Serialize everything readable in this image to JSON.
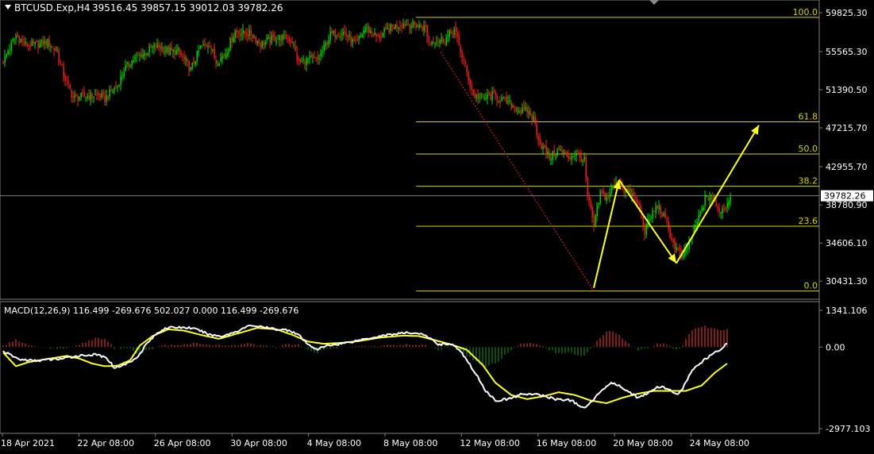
{
  "header": {
    "symbol": "BTCUSD.Exp,H4",
    "ohlc": "39516.45 39857.15 39012.03 39782.26"
  },
  "colors": {
    "background": "#000000",
    "bull_candle": "#00e000",
    "bear_candle": "#ff2020",
    "fib_lines": "#d4d400",
    "arrows": "#ffff22",
    "bid_line": "#7f7f7f",
    "macd_main": "#ffffff",
    "macd_signal": "#ffff22",
    "hist_pos": "#ff3b3b",
    "hist_neg": "#1e9a1e",
    "axis_text": "#ffffff",
    "price_box_bg": "#ffffff",
    "price_box_text": "#000000"
  },
  "price_axis": {
    "labels": [
      "59825.30",
      "55565.30",
      "51390.50",
      "47215.70",
      "42955.70",
      "38780.90",
      "34606.10",
      "30431.30"
    ],
    "current_price": "39782.26"
  },
  "fibonacci": {
    "levels": [
      {
        "label": "100.0",
        "price": 59320
      },
      {
        "label": "61.8",
        "price": 47880
      },
      {
        "label": "50.0",
        "price": 44360
      },
      {
        "label": "38.2",
        "price": 40830
      },
      {
        "label": "23.6",
        "price": 36450
      },
      {
        "label": "0.0",
        "price": 29350
      }
    ]
  },
  "macd": {
    "label": "MACD(12,26,9) 116.499 -269.676 502.027 0.000 116.499 -269.676",
    "axis_labels": [
      "1341.106",
      "0.00",
      "-2977.103"
    ],
    "ylim": [
      -2977.103,
      1341.106
    ]
  },
  "time_axis": {
    "labels": [
      "18 Apr 2021",
      "22 Apr 08:00",
      "26 Apr 08:00",
      "30 Apr 08:00",
      "4 May 08:00",
      "8 May 08:00",
      "12 May 08:00",
      "16 May 08:00",
      "20 May 08:00",
      "24 May 08:00"
    ]
  },
  "chart_data": {
    "type": "candlestick",
    "symbol": "BTCUSD.Exp,H4",
    "ylim": [
      28800,
      60800
    ],
    "price_anchors": [
      [
        0,
        54500
      ],
      [
        4,
        56000
      ],
      [
        8,
        57300
      ],
      [
        14,
        56300
      ],
      [
        20,
        56300
      ],
      [
        28,
        56600
      ],
      [
        34,
        55500
      ],
      [
        38,
        53000
      ],
      [
        44,
        50500
      ],
      [
        52,
        50700
      ],
      [
        60,
        50800
      ],
      [
        64,
        50400
      ],
      [
        68,
        51200
      ],
      [
        72,
        51800
      ],
      [
        76,
        53600
      ],
      [
        82,
        54700
      ],
      [
        90,
        55500
      ],
      [
        96,
        56200
      ],
      [
        104,
        55600
      ],
      [
        110,
        55600
      ],
      [
        118,
        53600
      ],
      [
        124,
        56000
      ],
      [
        130,
        56400
      ],
      [
        134,
        54400
      ],
      [
        140,
        55400
      ],
      [
        146,
        57800
      ],
      [
        150,
        57600
      ],
      [
        156,
        57500
      ],
      [
        162,
        56400
      ],
      [
        170,
        57000
      ],
      [
        178,
        57100
      ],
      [
        182,
        56700
      ],
      [
        186,
        54300
      ],
      [
        192,
        54700
      ],
      [
        198,
        54600
      ],
      [
        206,
        57400
      ],
      [
        214,
        57700
      ],
      [
        222,
        56300
      ],
      [
        228,
        58200
      ],
      [
        236,
        57100
      ],
      [
        242,
        58000
      ],
      [
        250,
        58600
      ],
      [
        258,
        58500
      ],
      [
        266,
        58200
      ],
      [
        268,
        56600
      ],
      [
        272,
        56800
      ],
      [
        278,
        56900
      ],
      [
        284,
        58000
      ],
      [
        290,
        54500
      ],
      [
        296,
        50800
      ],
      [
        302,
        50400
      ],
      [
        308,
        50800
      ],
      [
        314,
        50300
      ],
      [
        320,
        49700
      ],
      [
        326,
        49000
      ],
      [
        330,
        49100
      ],
      [
        334,
        48200
      ],
      [
        338,
        45500
      ],
      [
        344,
        44000
      ],
      [
        350,
        44800
      ],
      [
        356,
        44000
      ],
      [
        360,
        44400
      ],
      [
        366,
        43600
      ],
      [
        368,
        39700
      ],
      [
        372,
        36500
      ],
      [
        376,
        40000
      ],
      [
        380,
        39500
      ],
      [
        384,
        40800
      ],
      [
        388,
        41300
      ],
      [
        392,
        40300
      ],
      [
        396,
        39800
      ],
      [
        400,
        38800
      ],
      [
        404,
        36000
      ],
      [
        408,
        37600
      ],
      [
        412,
        38700
      ],
      [
        418,
        36800
      ],
      [
        422,
        34500
      ],
      [
        428,
        33000
      ],
      [
        434,
        35500
      ],
      [
        438,
        37400
      ],
      [
        442,
        39400
      ],
      [
        446,
        39700
      ],
      [
        450,
        38200
      ],
      [
        454,
        38300
      ],
      [
        458,
        39800
      ]
    ],
    "macd_main_anchors": [
      [
        0,
        -150
      ],
      [
        10,
        -450
      ],
      [
        20,
        -500
      ],
      [
        30,
        -450
      ],
      [
        38,
        -420
      ],
      [
        44,
        -350
      ],
      [
        50,
        -300
      ],
      [
        60,
        -280
      ],
      [
        66,
        -450
      ],
      [
        70,
        -750
      ],
      [
        76,
        -650
      ],
      [
        82,
        -480
      ],
      [
        86,
        -250
      ],
      [
        90,
        100
      ],
      [
        96,
        450
      ],
      [
        102,
        700
      ],
      [
        110,
        720
      ],
      [
        118,
        700
      ],
      [
        124,
        600
      ],
      [
        130,
        450
      ],
      [
        138,
        400
      ],
      [
        146,
        550
      ],
      [
        156,
        800
      ],
      [
        164,
        720
      ],
      [
        172,
        650
      ],
      [
        180,
        620
      ],
      [
        186,
        450
      ],
      [
        192,
        80
      ],
      [
        198,
        -80
      ],
      [
        204,
        50
      ],
      [
        212,
        120
      ],
      [
        220,
        200
      ],
      [
        228,
        300
      ],
      [
        240,
        430
      ],
      [
        250,
        500
      ],
      [
        256,
        520
      ],
      [
        262,
        500
      ],
      [
        268,
        350
      ],
      [
        274,
        100
      ],
      [
        280,
        120
      ],
      [
        284,
        60
      ],
      [
        290,
        -300
      ],
      [
        298,
        -1000
      ],
      [
        304,
        -1600
      ],
      [
        310,
        -1950
      ],
      [
        318,
        -1900
      ],
      [
        328,
        -1700
      ],
      [
        338,
        -1750
      ],
      [
        348,
        -1900
      ],
      [
        358,
        -1950
      ],
      [
        366,
        -2250
      ],
      [
        372,
        -1900
      ],
      [
        378,
        -1500
      ],
      [
        384,
        -1300
      ],
      [
        392,
        -1550
      ],
      [
        400,
        -1850
      ],
      [
        406,
        -1700
      ],
      [
        412,
        -1450
      ],
      [
        418,
        -1500
      ],
      [
        424,
        -1750
      ],
      [
        428,
        -1500
      ],
      [
        434,
        -850
      ],
      [
        442,
        -450
      ],
      [
        450,
        -150
      ],
      [
        456,
        120
      ]
    ],
    "macd_signal_anchors": [
      [
        0,
        -200
      ],
      [
        8,
        -700
      ],
      [
        16,
        -550
      ],
      [
        26,
        -450
      ],
      [
        34,
        -380
      ],
      [
        40,
        -320
      ],
      [
        48,
        -420
      ],
      [
        56,
        -600
      ],
      [
        64,
        -700
      ],
      [
        72,
        -680
      ],
      [
        80,
        -480
      ],
      [
        86,
        50
      ],
      [
        94,
        400
      ],
      [
        104,
        650
      ],
      [
        114,
        600
      ],
      [
        124,
        450
      ],
      [
        136,
        300
      ],
      [
        148,
        500
      ],
      [
        160,
        700
      ],
      [
        172,
        650
      ],
      [
        182,
        450
      ],
      [
        192,
        200
      ],
      [
        202,
        120
      ],
      [
        212,
        150
      ],
      [
        224,
        220
      ],
      [
        238,
        350
      ],
      [
        252,
        420
      ],
      [
        262,
        400
      ],
      [
        272,
        250
      ],
      [
        282,
        100
      ],
      [
        292,
        -100
      ],
      [
        302,
        -650
      ],
      [
        310,
        -1300
      ],
      [
        320,
        -1750
      ],
      [
        330,
        -1900
      ],
      [
        340,
        -1800
      ],
      [
        350,
        -1650
      ],
      [
        360,
        -1750
      ],
      [
        370,
        -1950
      ],
      [
        380,
        -2050
      ],
      [
        390,
        -1850
      ],
      [
        400,
        -1700
      ],
      [
        410,
        -1600
      ],
      [
        420,
        -1600
      ],
      [
        430,
        -1600
      ],
      [
        440,
        -1400
      ],
      [
        448,
        -950
      ],
      [
        456,
        -600
      ]
    ],
    "arrows": [
      {
        "from": [
          372,
          29700
        ],
        "to": [
          388,
          41500
        ]
      },
      {
        "from": [
          388,
          41500
        ],
        "to": [
          424,
          32400
        ]
      },
      {
        "from": [
          424,
          32400
        ],
        "to": [
          476,
          47500
        ]
      }
    ]
  }
}
